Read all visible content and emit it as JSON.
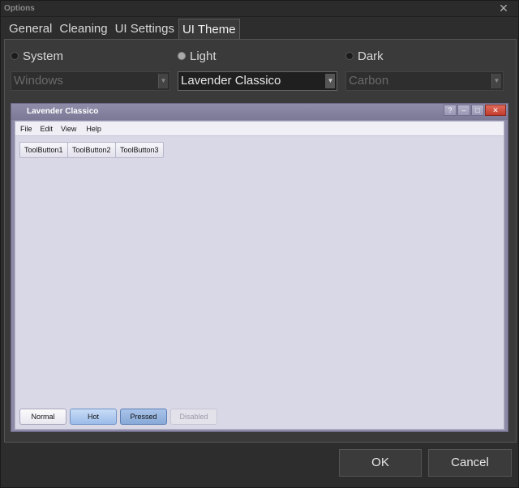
{
  "window": {
    "title": "Options"
  },
  "tabs": [
    "General",
    "Cleaning",
    "UI Settings",
    "UI Theme"
  ],
  "theme": {
    "radios": [
      {
        "label": "System",
        "checked": false
      },
      {
        "label": "Light",
        "checked": true
      },
      {
        "label": "Dark",
        "checked": false
      }
    ],
    "combos": [
      {
        "value": "Windows",
        "enabled": false
      },
      {
        "value": "Lavender Classico",
        "enabled": true
      },
      {
        "value": "Carbon",
        "enabled": false
      }
    ]
  },
  "preview": {
    "title": "Lavender Classico",
    "window_buttons": [
      "?",
      "–",
      "□",
      "✕"
    ],
    "menu": [
      "File",
      "Edit",
      "View",
      "Help"
    ],
    "toolbuttons": [
      "ToolButton1",
      "ToolButton2",
      "ToolButton3"
    ],
    "states": [
      "Normal",
      "Hot",
      "Pressed",
      "Disabled"
    ]
  },
  "buttons": {
    "ok": "OK",
    "cancel": "Cancel"
  },
  "colors": {
    "accent_hot": "#9cbce9",
    "preview_frame": "#8c8aa6",
    "preview_body": "#d9d8e6"
  }
}
